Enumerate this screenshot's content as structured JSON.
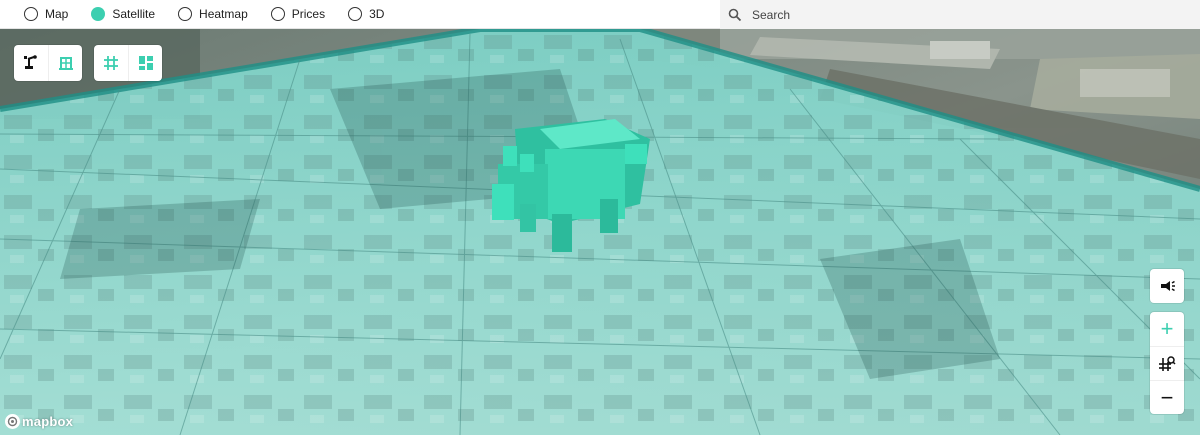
{
  "view_modes": [
    {
      "label": "Map",
      "selected": false
    },
    {
      "label": "Satellite",
      "selected": true
    },
    {
      "label": "Heatmap",
      "selected": false
    },
    {
      "label": "Prices",
      "selected": false
    },
    {
      "label": "3D",
      "selected": false
    }
  ],
  "search": {
    "placeholder": "Search",
    "icon": "search-icon"
  },
  "toolbar_left": {
    "group_1": [
      "draw-tool-icon",
      "building-icon"
    ],
    "group_2": [
      "grid-icon",
      "layout-icon"
    ]
  },
  "toolbar_right": {
    "announce_icon": "megaphone-icon",
    "zoom_in_label": "+",
    "zoom_out_label": "−",
    "locate_icon": "grid-search-icon"
  },
  "attribution": {
    "logo_text": "mapbox"
  },
  "colors": {
    "accent": "#3ccfb0",
    "overlay": "#8fe3d8",
    "model": "#3dd8b4"
  }
}
